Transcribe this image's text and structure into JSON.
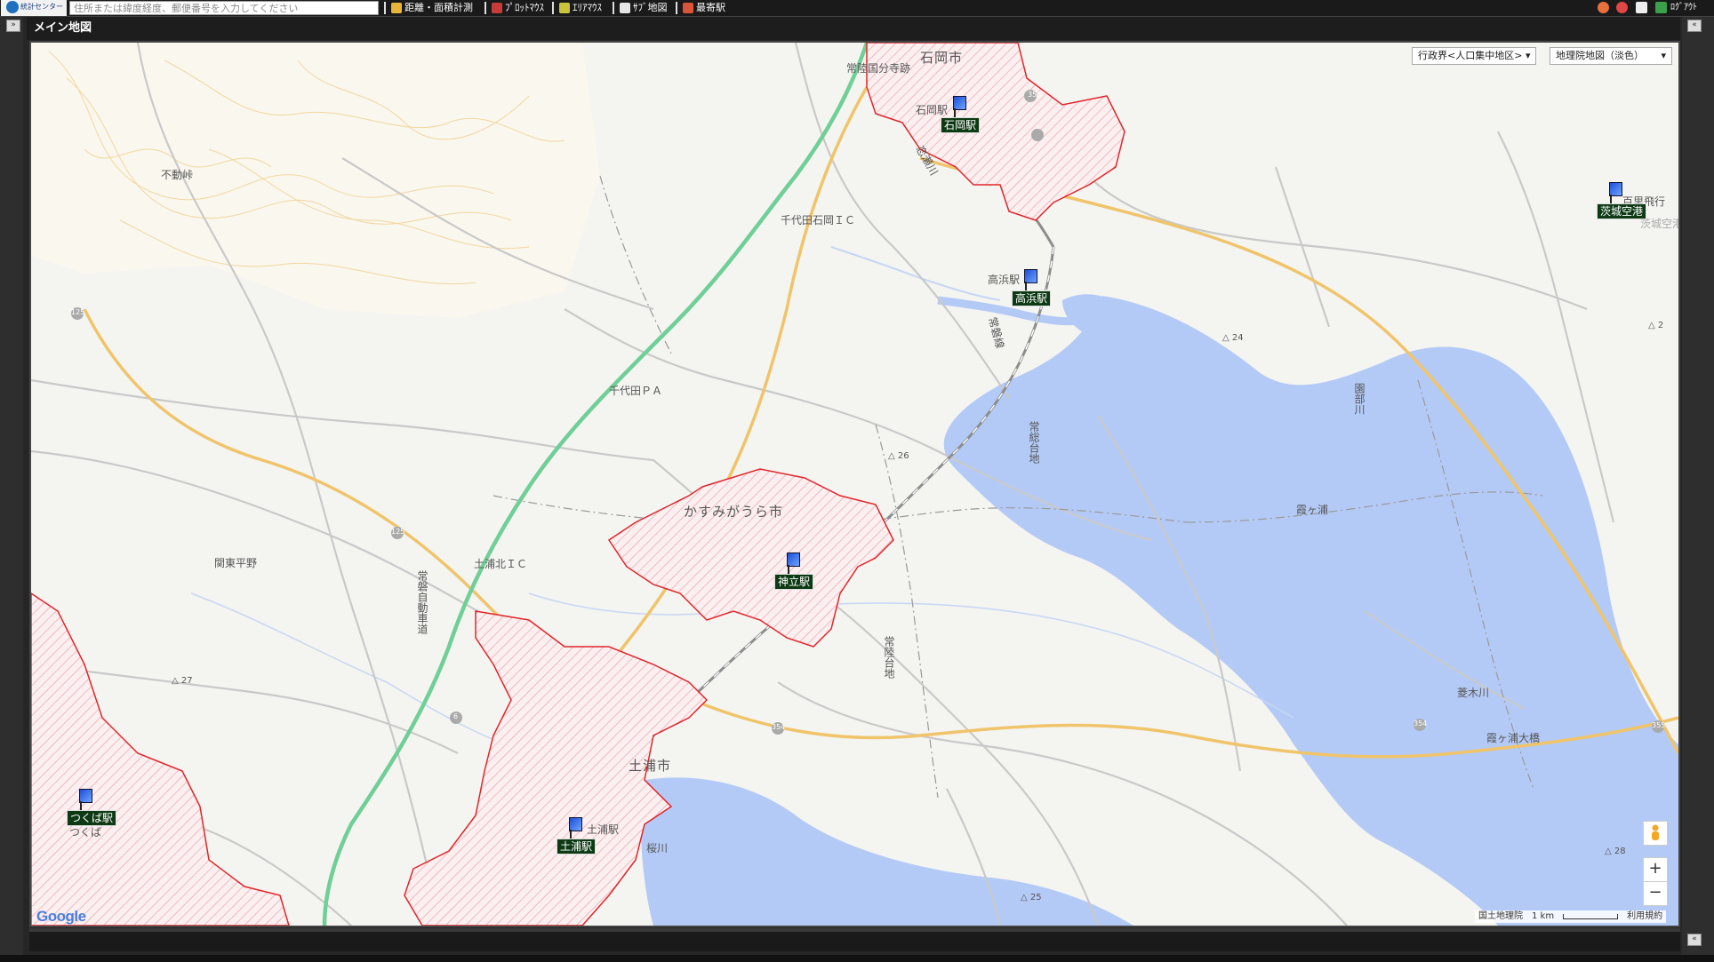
{
  "toolbar": {
    "logo_text": "統計センター",
    "search_placeholder": "住所または緯度経度、郵便番号を入力してください",
    "buttons": [
      {
        "label": "距離・面積計測",
        "icon": "ruler-icon"
      },
      {
        "label": "ﾌﾟﾛｯﾄﾏｳｽ",
        "icon": "plot-mouse-icon"
      },
      {
        "label": "ｴﾘｱﾏｳｽ",
        "icon": "area-mouse-icon"
      },
      {
        "label": "ｻﾌﾞ地図",
        "icon": "sub-map-icon"
      },
      {
        "label": "最寄駅",
        "icon": "nearest-station-icon"
      }
    ],
    "logout_label": "ﾛｸﾞｱｳﾄ"
  },
  "panel": {
    "title": "メイン地図"
  },
  "map": {
    "boundary_select": "行政界<人口集中地区>",
    "basemap_select": "地理院地図（淡色）",
    "attribution": "国土地理院",
    "scale_label": "1 km",
    "terms_label": "利用規約",
    "google_logo": "Google",
    "cities": [
      "石岡市",
      "かすみがうら市",
      "土浦市"
    ],
    "places": [
      "常陸国分寺跡",
      "石岡駅",
      "不動峠",
      "千代田石岡ＩＣ",
      "高浜駅",
      "恋瀬川",
      "千代田ＰＡ",
      "常磐線",
      "常総台地",
      "百里飛行",
      "茨城空港",
      "土浦北ＩＣ",
      "関東平野",
      "常磐自動車道",
      "常陸台地",
      "霞ヶ浦",
      "霞ヶ浦大橋",
      "菱木川",
      "土浦駅",
      "桜川",
      "園部川",
      "つくば"
    ],
    "elevations": [
      "24",
      "26",
      "27",
      "28",
      "25",
      "2"
    ],
    "route_numbers": [
      "125",
      "125",
      "6",
      "354",
      "354",
      "355",
      "355",
      "6"
    ],
    "stations": [
      {
        "name": "石岡駅"
      },
      {
        "name": "高浜駅"
      },
      {
        "name": "神立駅"
      },
      {
        "name": "茨城空港"
      },
      {
        "name": "つくば駅"
      },
      {
        "name": "土浦駅"
      }
    ]
  },
  "colors": {
    "water": "#b4caf6",
    "expressway": "#6fcf96",
    "national_road": "#f0c46a",
    "dense_area_border": "#e0262b",
    "terrain_contour": "#f2d7a0"
  }
}
